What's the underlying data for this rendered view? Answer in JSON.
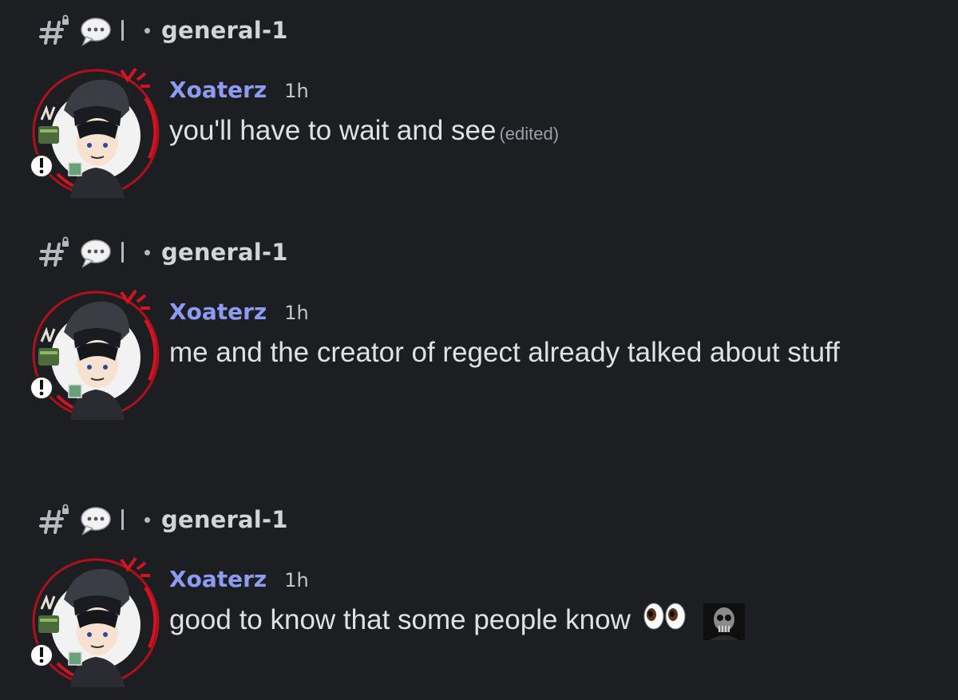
{
  "messages": [
    {
      "channel": "general-1",
      "author": "Xoaterz",
      "time": "1h",
      "text": "you'll have to wait and see",
      "edited_label": "(edited)"
    },
    {
      "channel": "general-1",
      "author": "Xoaterz",
      "time": "1h",
      "text": "me and the creator of regect already talked about stuff"
    },
    {
      "channel": "general-1",
      "author": "Xoaterz",
      "time": "1h",
      "text": "good to know that some people know",
      "emoji": "eyes",
      "attachment": "skull-sticker"
    }
  ],
  "colors": {
    "background": "#1d1e22",
    "author": "#8e9bf2",
    "text": "#dfe1e5",
    "muted": "#b5bac1",
    "avatar_ring": "#c0121d"
  }
}
